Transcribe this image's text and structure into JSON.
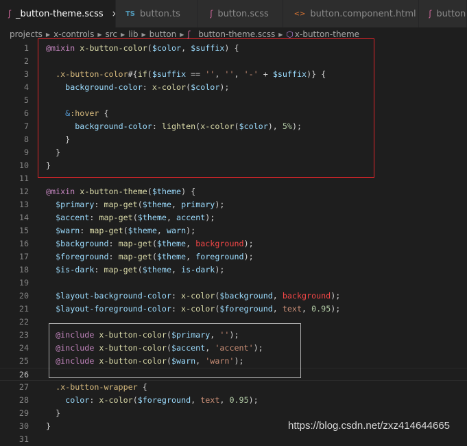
{
  "tabs": [
    {
      "label": "_button-theme.scss",
      "icon": "sass-icon",
      "active": true
    },
    {
      "label": "button.ts",
      "icon": "typescript-icon",
      "active": false
    },
    {
      "label": "button.scss",
      "icon": "sass-icon",
      "active": false
    },
    {
      "label": "button.component.html",
      "icon": "html-icon",
      "active": false
    },
    {
      "label": "button",
      "icon": "sass-icon",
      "active": false
    }
  ],
  "icons": {
    "sass": "ʃ",
    "ts": "TS",
    "html": "<>",
    "close": "×",
    "symbol": "⬡"
  },
  "breadcrumb": [
    "projects",
    "x-controls",
    "src",
    "lib",
    "button",
    "_button-theme.scss",
    "x-button-theme"
  ],
  "current_line": 26,
  "lines": [
    [
      [
        "@mixin",
        "k"
      ],
      [
        " "
      ],
      [
        "x-button-color",
        "f"
      ],
      [
        "("
      ],
      [
        "$color",
        "v"
      ],
      [
        ", "
      ],
      [
        "$suffix",
        "v"
      ],
      [
        ") {"
      ]
    ],
    [],
    [
      [
        "  "
      ],
      [
        ".x-button-color",
        "s"
      ],
      [
        "#{"
      ],
      [
        "if",
        "f"
      ],
      [
        "("
      ],
      [
        "$suffix",
        "v"
      ],
      [
        " == "
      ],
      [
        "''",
        "st"
      ],
      [
        ", "
      ],
      [
        "''",
        "st"
      ],
      [
        ", "
      ],
      [
        "'-'",
        "st"
      ],
      [
        " + "
      ],
      [
        "$suffix",
        "v"
      ],
      [
        ")} {"
      ]
    ],
    [
      [
        "    "
      ],
      [
        "background-color",
        "v"
      ],
      [
        ": "
      ],
      [
        "x-color",
        "f"
      ],
      [
        "("
      ],
      [
        "$color",
        "v"
      ],
      [
        ");"
      ]
    ],
    [],
    [
      [
        "    "
      ],
      [
        "&",
        "a"
      ],
      [
        ":hover",
        "s"
      ],
      [
        " {"
      ]
    ],
    [
      [
        "      "
      ],
      [
        "background-color",
        "v"
      ],
      [
        ": "
      ],
      [
        "lighten",
        "f"
      ],
      [
        "("
      ],
      [
        "x-color",
        "f"
      ],
      [
        "("
      ],
      [
        "$color",
        "v"
      ],
      [
        "), "
      ],
      [
        "5%",
        "n"
      ],
      [
        ");"
      ]
    ],
    [
      [
        "    }"
      ]
    ],
    [
      [
        "  }"
      ]
    ],
    [
      [
        "}"
      ]
    ],
    [],
    [
      [
        "@mixin",
        "k"
      ],
      [
        " "
      ],
      [
        "x-button-theme",
        "f"
      ],
      [
        "("
      ],
      [
        "$theme",
        "v"
      ],
      [
        ") {"
      ]
    ],
    [
      [
        "  "
      ],
      [
        "$primary",
        "v"
      ],
      [
        ": "
      ],
      [
        "map-get",
        "f"
      ],
      [
        "("
      ],
      [
        "$theme",
        "v"
      ],
      [
        ", "
      ],
      [
        "primary",
        "v"
      ],
      [
        ");"
      ]
    ],
    [
      [
        "  "
      ],
      [
        "$accent",
        "v"
      ],
      [
        ": "
      ],
      [
        "map-get",
        "f"
      ],
      [
        "("
      ],
      [
        "$theme",
        "v"
      ],
      [
        ", "
      ],
      [
        "accent",
        "v"
      ],
      [
        ");"
      ]
    ],
    [
      [
        "  "
      ],
      [
        "$warn",
        "v"
      ],
      [
        ": "
      ],
      [
        "map-get",
        "f"
      ],
      [
        "("
      ],
      [
        "$theme",
        "v"
      ],
      [
        ", "
      ],
      [
        "warn",
        "v"
      ],
      [
        ");"
      ]
    ],
    [
      [
        "  "
      ],
      [
        "$background",
        "v"
      ],
      [
        ": "
      ],
      [
        "map-get",
        "f"
      ],
      [
        "("
      ],
      [
        "$theme",
        "v"
      ],
      [
        ", "
      ],
      [
        "background",
        "r"
      ],
      [
        ");"
      ]
    ],
    [
      [
        "  "
      ],
      [
        "$foreground",
        "v"
      ],
      [
        ": "
      ],
      [
        "map-get",
        "f"
      ],
      [
        "("
      ],
      [
        "$theme",
        "v"
      ],
      [
        ", "
      ],
      [
        "foreground",
        "v"
      ],
      [
        ");"
      ]
    ],
    [
      [
        "  "
      ],
      [
        "$is-dark",
        "v"
      ],
      [
        ": "
      ],
      [
        "map-get",
        "f"
      ],
      [
        "("
      ],
      [
        "$theme",
        "v"
      ],
      [
        ", "
      ],
      [
        "is-dark",
        "v"
      ],
      [
        ");"
      ]
    ],
    [],
    [
      [
        "  "
      ],
      [
        "$layout-background-color",
        "v"
      ],
      [
        ": "
      ],
      [
        "x-color",
        "f"
      ],
      [
        "("
      ],
      [
        "$background",
        "v"
      ],
      [
        ", "
      ],
      [
        "background",
        "r"
      ],
      [
        ");"
      ]
    ],
    [
      [
        "  "
      ],
      [
        "$layout-foreground-color",
        "v"
      ],
      [
        ": "
      ],
      [
        "x-color",
        "f"
      ],
      [
        "("
      ],
      [
        "$foreground",
        "v"
      ],
      [
        ", "
      ],
      [
        "text",
        "st"
      ],
      [
        ", "
      ],
      [
        "0.95",
        "n"
      ],
      [
        ");"
      ]
    ],
    [],
    [
      [
        "  "
      ],
      [
        "@include",
        "k"
      ],
      [
        " "
      ],
      [
        "x-button-color",
        "f"
      ],
      [
        "("
      ],
      [
        "$primary",
        "v"
      ],
      [
        ", "
      ],
      [
        "''",
        "st"
      ],
      [
        ");"
      ]
    ],
    [
      [
        "  "
      ],
      [
        "@include",
        "k"
      ],
      [
        " "
      ],
      [
        "x-button-color",
        "f"
      ],
      [
        "("
      ],
      [
        "$accent",
        "v"
      ],
      [
        ", "
      ],
      [
        "'accent'",
        "st"
      ],
      [
        ");"
      ]
    ],
    [
      [
        "  "
      ],
      [
        "@include",
        "k"
      ],
      [
        " "
      ],
      [
        "x-button-color",
        "f"
      ],
      [
        "("
      ],
      [
        "$warn",
        "v"
      ],
      [
        ", "
      ],
      [
        "'warn'",
        "st"
      ],
      [
        ");"
      ]
    ],
    [],
    [
      [
        "  "
      ],
      [
        ".x-button-wrapper",
        "s"
      ],
      [
        " {"
      ]
    ],
    [
      [
        "    "
      ],
      [
        "color",
        "v"
      ],
      [
        ": "
      ],
      [
        "x-color",
        "f"
      ],
      [
        "("
      ],
      [
        "$foreground",
        "v"
      ],
      [
        ", "
      ],
      [
        "text",
        "st"
      ],
      [
        ", "
      ],
      [
        "0.95",
        "n"
      ],
      [
        ");"
      ]
    ],
    [
      [
        "  }"
      ]
    ],
    [
      [
        "}"
      ]
    ],
    []
  ],
  "watermark": "https://blog.csdn.net/zxz414644665",
  "colors": {
    "keyword": "#C586C0",
    "function": "#DCDCAA",
    "variable": "#9CDCFE",
    "selector": "#D7BA7D",
    "string": "#CE9178",
    "number": "#B5CEA8",
    "annotation_box": "#e0252a"
  }
}
